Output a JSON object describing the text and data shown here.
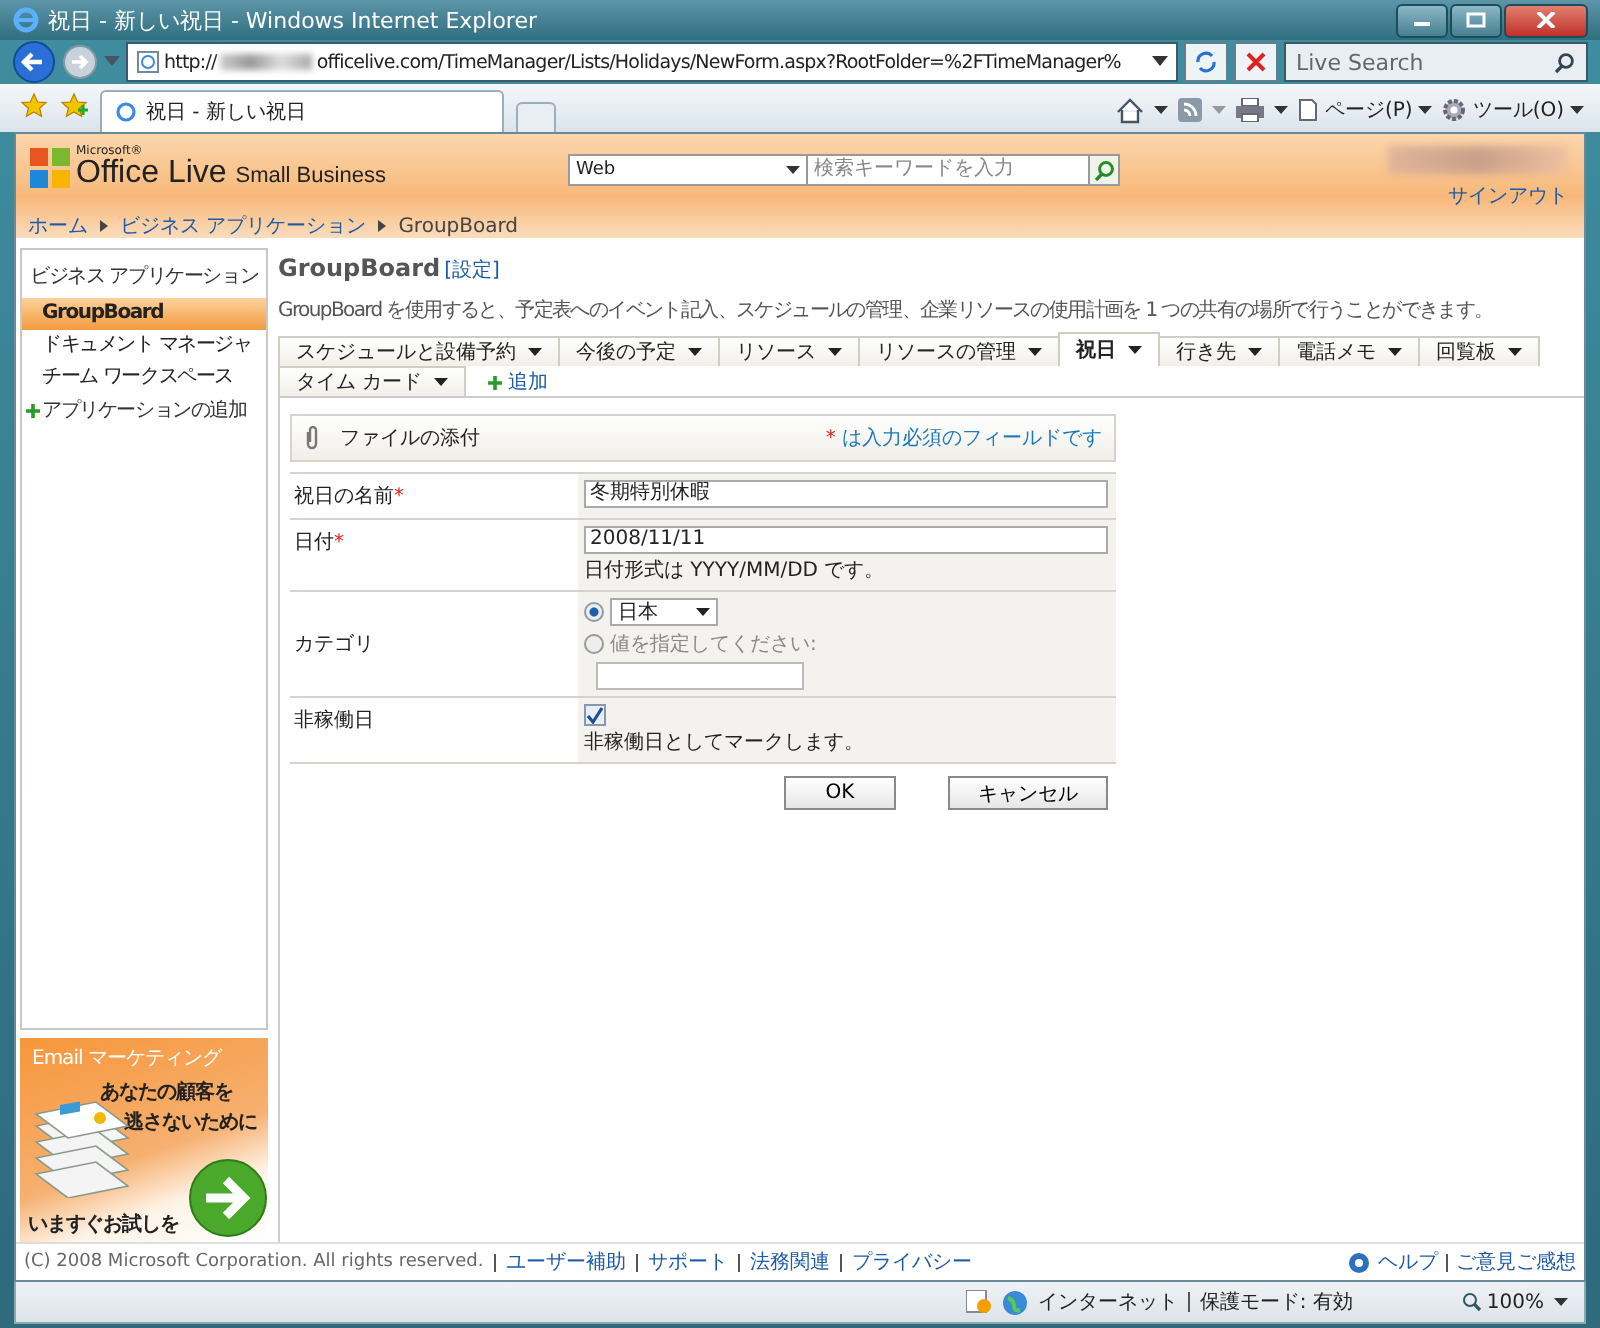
{
  "window": {
    "title": "祝日 - 新しい祝日 - Windows Internet Explorer"
  },
  "address_bar": {
    "scheme": "http://",
    "url": "officelive.com/TimeManager/Lists/Holidays/NewForm.aspx?RootFolder=%2FTimeManager%"
  },
  "search": {
    "placeholder": "Live Search"
  },
  "browser_tabs": [
    {
      "label": "祝日 - 新しい祝日",
      "selected": true
    }
  ],
  "command_bar": {
    "page_menu": "ページ(P)",
    "tools_menu": "ツール(O)"
  },
  "site_header": {
    "logo_small": "Microsoft®",
    "logo": "Office Live",
    "logo_suffix": "Small Business",
    "search_scope": "Web",
    "search_placeholder": "検索キーワードを入力",
    "sign_out": "サインアウト"
  },
  "breadcrumb": [
    "ホーム",
    "ビジネス アプリケーション",
    "GroupBoard"
  ],
  "sidebar": {
    "heading": "ビジネス アプリケーション",
    "items": [
      {
        "label": "GroupBoard",
        "selected": true
      },
      {
        "label": "ドキュメント マネージャ",
        "selected": false
      },
      {
        "label": "チーム ワークスペース",
        "selected": false
      }
    ],
    "add_link": "アプリケーションの追加"
  },
  "ad": {
    "title": "Email マーケティング",
    "line_1": "あなたの顧客を",
    "line_2": "逃さないために",
    "cta": "いますぐお試しを"
  },
  "page": {
    "title": "GroupBoard",
    "settings_link": "[設定]",
    "description": "GroupBoard を使用すると、予定表へのイベント記入、スケジュールの管理、企業リソースの使用計画を 1 つの共有の場所で行うことができます。"
  },
  "tab_rows": [
    [
      {
        "label": "スケジュールと設備予約",
        "selected": false
      },
      {
        "label": "今後の予定",
        "selected": false
      },
      {
        "label": "リソース",
        "selected": false
      },
      {
        "label": "リソースの管理",
        "selected": false
      },
      {
        "label": "祝日",
        "selected": true
      },
      {
        "label": "行き先",
        "selected": false
      },
      {
        "label": "電話メモ",
        "selected": false
      },
      {
        "label": "回覧板",
        "selected": false
      }
    ],
    [
      {
        "label": "タイム カード",
        "selected": false
      }
    ]
  ],
  "add_tab": "追加",
  "toolbar": {
    "attach": "ファイルの添付",
    "required_mark": "*",
    "required_note": "は入力必須のフィールドです"
  },
  "fields": [
    {
      "kind": "text",
      "label": "祝日の名前",
      "required_mark": "*",
      "value": "冬期特別休暇"
    },
    {
      "kind": "text",
      "label": "日付",
      "required_mark": "*",
      "value": "2008/11/11",
      "hint": "日付形式は YYYY/MM/DD です。"
    },
    {
      "kind": "choice",
      "label": "カテゴリ",
      "dropdown": {
        "value": "日本",
        "selected": true
      },
      "custom": {
        "label": "値を指定してください:",
        "selected": false
      }
    },
    {
      "kind": "checkbox",
      "label": "非稼働日",
      "checked": true,
      "hint": "非稼働日としてマークします。"
    }
  ],
  "buttons": [
    "OK",
    "キャンセル"
  ],
  "footer": {
    "copyright": "(C) 2008 Microsoft Corporation. All rights reserved.",
    "links": [
      "ユーザー補助",
      "サポート",
      "法務関連",
      "プライバシー"
    ],
    "help": "ヘルプ",
    "feedback": "ご意見ご感想"
  },
  "status_bar": {
    "zone": "インターネット",
    "protected_mode": "保護モード: 有効",
    "zoom": "100%"
  }
}
